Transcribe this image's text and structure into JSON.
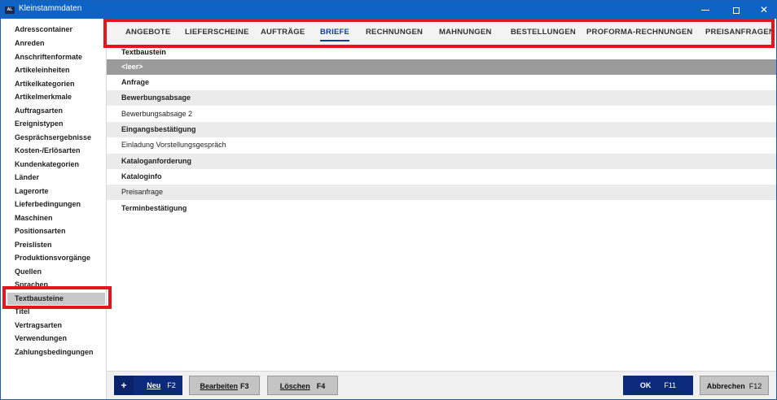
{
  "window": {
    "title": "Kleinstammdaten",
    "icon_text": "AL"
  },
  "sidebar": {
    "items": [
      {
        "label": "Adresscontainer"
      },
      {
        "label": "Anreden"
      },
      {
        "label": "Anschriftenformate"
      },
      {
        "label": "Artikeleinheiten"
      },
      {
        "label": "Artikelkategorien"
      },
      {
        "label": "Artikelmerkmale"
      },
      {
        "label": "Auftragsarten"
      },
      {
        "label": "Ereignistypen"
      },
      {
        "label": "Gesprächsergebnisse"
      },
      {
        "label": "Kosten-/Erlösarten"
      },
      {
        "label": "Kundenkategorien"
      },
      {
        "label": "Länder"
      },
      {
        "label": "Lagerorte"
      },
      {
        "label": "Lieferbedingungen"
      },
      {
        "label": "Maschinen"
      },
      {
        "label": "Positionsarten"
      },
      {
        "label": "Preislisten"
      },
      {
        "label": "Produktionsvorgänge"
      },
      {
        "label": "Quellen"
      },
      {
        "label": "Sprachen"
      },
      {
        "label": "Textbausteine",
        "selected": true
      },
      {
        "label": "Titel"
      },
      {
        "label": "Vertragsarten"
      },
      {
        "label": "Verwendungen"
      },
      {
        "label": "Zahlungsbedingungen"
      }
    ]
  },
  "tabs": [
    {
      "label": "ANGEBOTE"
    },
    {
      "label": "LIEFERSCHEINE"
    },
    {
      "label": "AUFTRÄGE"
    },
    {
      "label": "BRIEFE",
      "active": true
    },
    {
      "label": "RECHNUNGEN"
    },
    {
      "label": "MAHNUNGEN"
    },
    {
      "label": "BESTELLUNGEN"
    },
    {
      "label": "PROFORMA-RECHNUNGEN"
    },
    {
      "label": "PREISANFRAGEN"
    }
  ],
  "grid": {
    "header": "Textbaustein",
    "rows": [
      {
        "label": "<leer>",
        "selected": true
      },
      {
        "label": "Anfrage"
      },
      {
        "label": "Bewerbungsabsage"
      },
      {
        "label": "Bewerbungsabsage 2"
      },
      {
        "label": "Eingangsbestätigung"
      },
      {
        "label": "Einladung Vorstellungsgespräch"
      },
      {
        "label": "Kataloganforderung"
      },
      {
        "label": "Kataloginfo"
      },
      {
        "label": "Preisanfrage"
      },
      {
        "label": "Terminbestätigung"
      }
    ]
  },
  "buttons": {
    "new": {
      "icon": "+",
      "label": "Neu",
      "key": "F2"
    },
    "edit": {
      "label": "Bearbeiten",
      "key": "F3"
    },
    "delete": {
      "label": "Löschen",
      "key": "F4"
    },
    "ok": {
      "label": "OK",
      "key": "F11"
    },
    "cancel": {
      "label": "Abbrechen",
      "key": "F12"
    }
  },
  "colors": {
    "titlebar": "#0d63c6",
    "accent": "#0f3f9c",
    "primary_button": "#0b2a79",
    "highlight": "#e6141b"
  }
}
